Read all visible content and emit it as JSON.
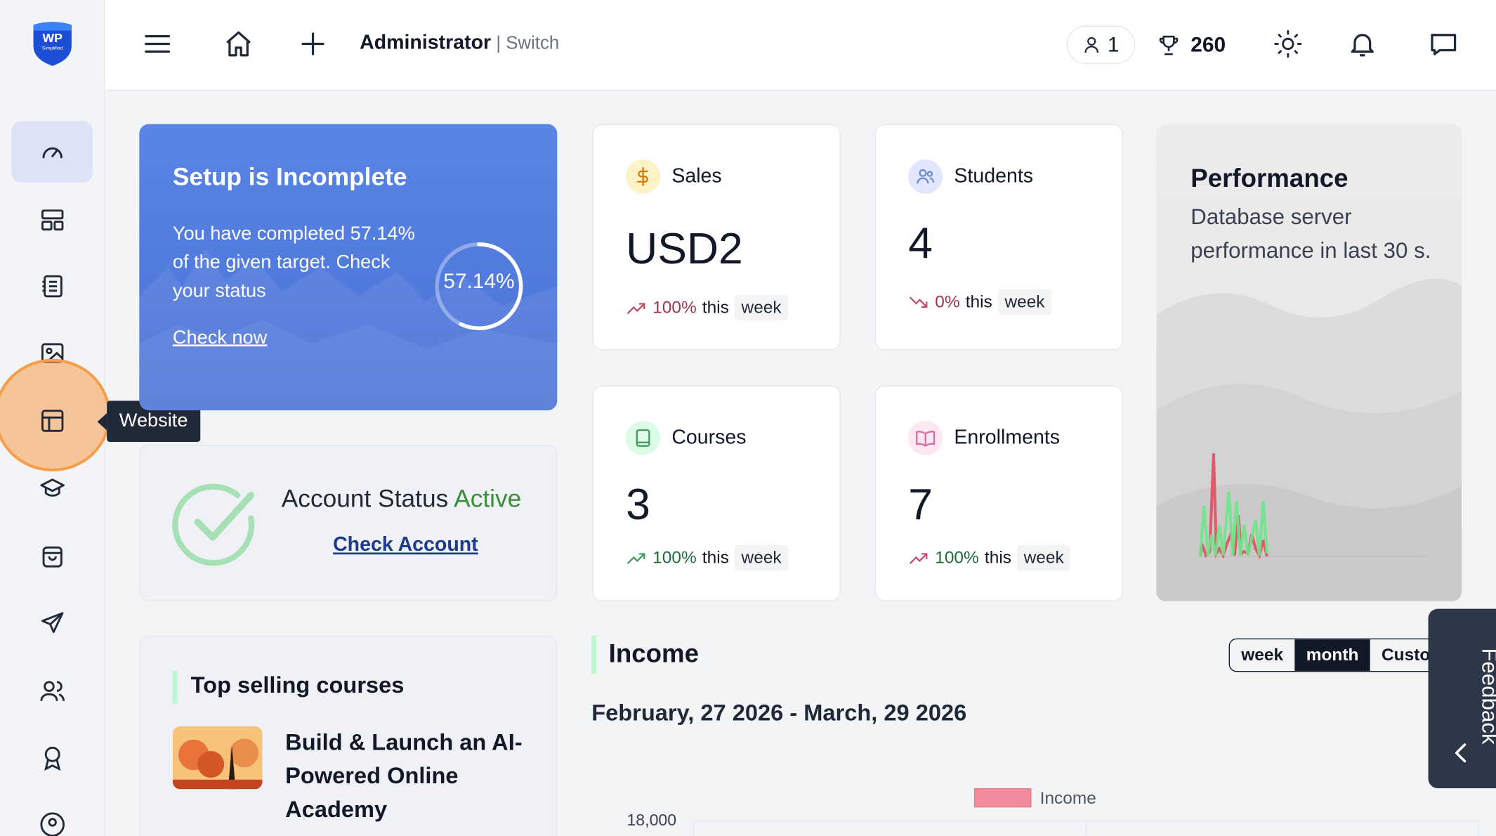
{
  "topbar": {
    "role": "Administrator",
    "separator": " | ",
    "switch_label": "Switch",
    "users_count": "1",
    "points": "260"
  },
  "sidebar": {
    "tooltip": "Website"
  },
  "setup": {
    "title": "Setup is Incomplete",
    "text": "You have completed 57.14% of the given target. Check your status",
    "link": "Check now",
    "progress_label": "57.14%",
    "progress": 0.5714
  },
  "account": {
    "status_prefix": "Account Status ",
    "status": "Active",
    "link": "Check Account"
  },
  "top_selling": {
    "title": "Top selling courses",
    "course_title": "Build & Launch an AI-Powered Online Academy"
  },
  "stats": {
    "sales": {
      "label": "Sales",
      "value": "USD2",
      "pct": "100%",
      "this": "this",
      "week": "week"
    },
    "students": {
      "label": "Students",
      "value": "4",
      "pct": "0%",
      "this": "this",
      "week": "week"
    },
    "courses": {
      "label": "Courses",
      "value": "3",
      "pct": "100%",
      "this": "this",
      "week": "week"
    },
    "enrollments": {
      "label": "Enrollments",
      "value": "7",
      "pct": "100%",
      "this": "this",
      "week": "week"
    }
  },
  "performance": {
    "title": "Performance",
    "text": "Database server performance in last 30 s."
  },
  "income": {
    "title": "Income",
    "range_buttons": [
      "week",
      "month",
      "Custo"
    ],
    "selected": "month",
    "date_range": "February, 27 2026 - March, 29 2026",
    "legend": "Income",
    "ytick_top": "18,000"
  },
  "feedback": {
    "label": "Feedback"
  },
  "colors": {
    "accent": "#4a72d6",
    "green": "#3a8d3a",
    "income_series": "#f08c9b",
    "highlight": "#f59e4b"
  }
}
